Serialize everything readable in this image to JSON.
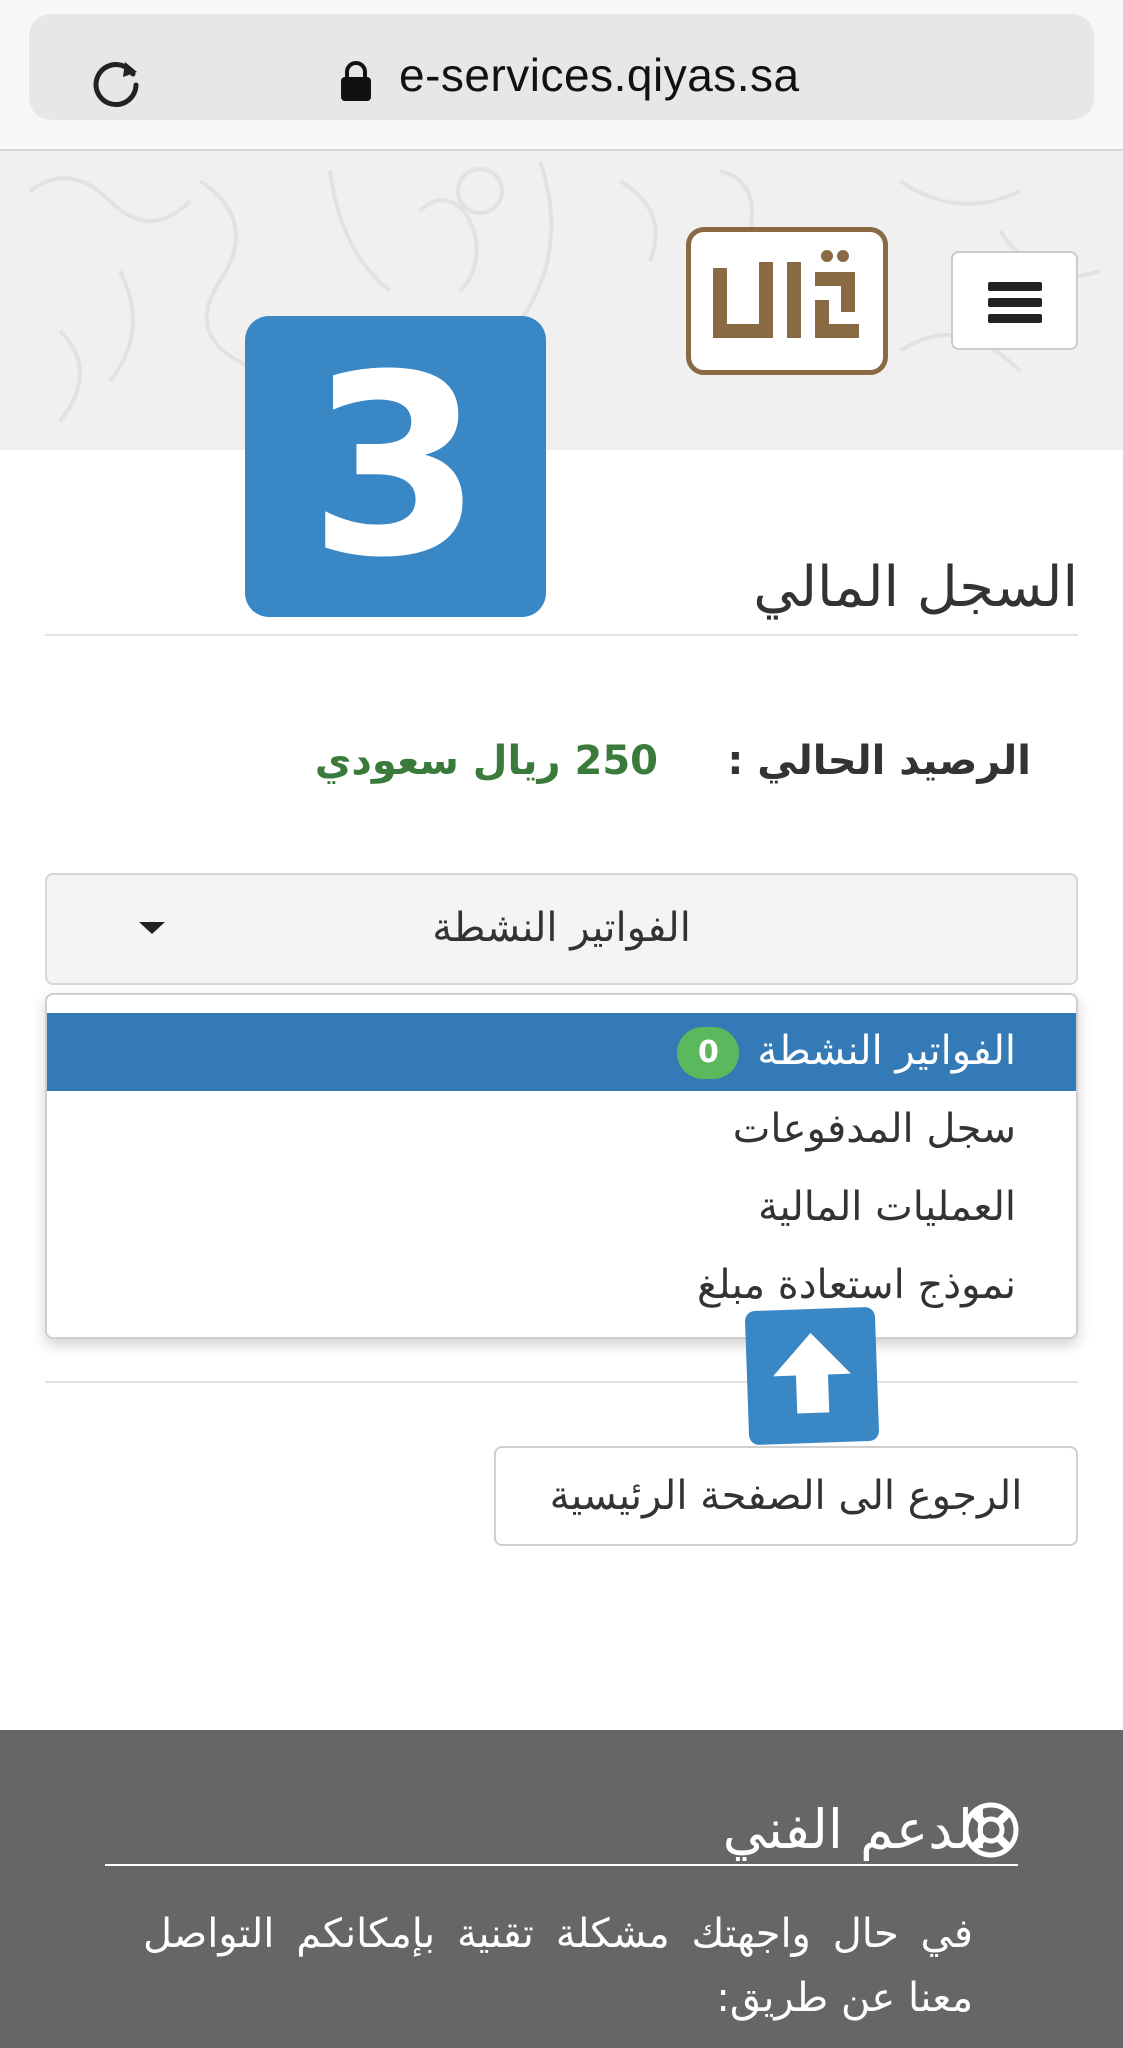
{
  "browser": {
    "url": "e-services.qiyas.sa"
  },
  "header": {
    "logo_alt": "قياس",
    "step_number": "3"
  },
  "page": {
    "title": "السجل المالي",
    "balance_label": "الرصيد الحالي :",
    "balance_value": "250 ريال سعودي",
    "select": {
      "selected": "الفواتير النشطة"
    },
    "dropdown": {
      "items": [
        {
          "label": "الفواتير النشطة",
          "badge": "0",
          "active": true
        },
        {
          "label": "سجل المدفوعات"
        },
        {
          "label": "العمليات المالية"
        },
        {
          "label": "نموذج استعادة مبلغ"
        }
      ]
    },
    "home_button": "الرجوع الى الصفحة الرئيسية"
  },
  "footer": {
    "support_title": "الدعم الفني",
    "support_text": "في حال واجهتك مشكلة تقنية بإمكانكم التواصل معنا عن طريق:"
  },
  "colors": {
    "accent_blue": "#3a87c6",
    "active_item": "#337ab7",
    "balance_green": "#3a7a3a",
    "badge_green": "#5cb85c",
    "logo_brown": "#8a6a45",
    "footer_bg": "#666666"
  }
}
